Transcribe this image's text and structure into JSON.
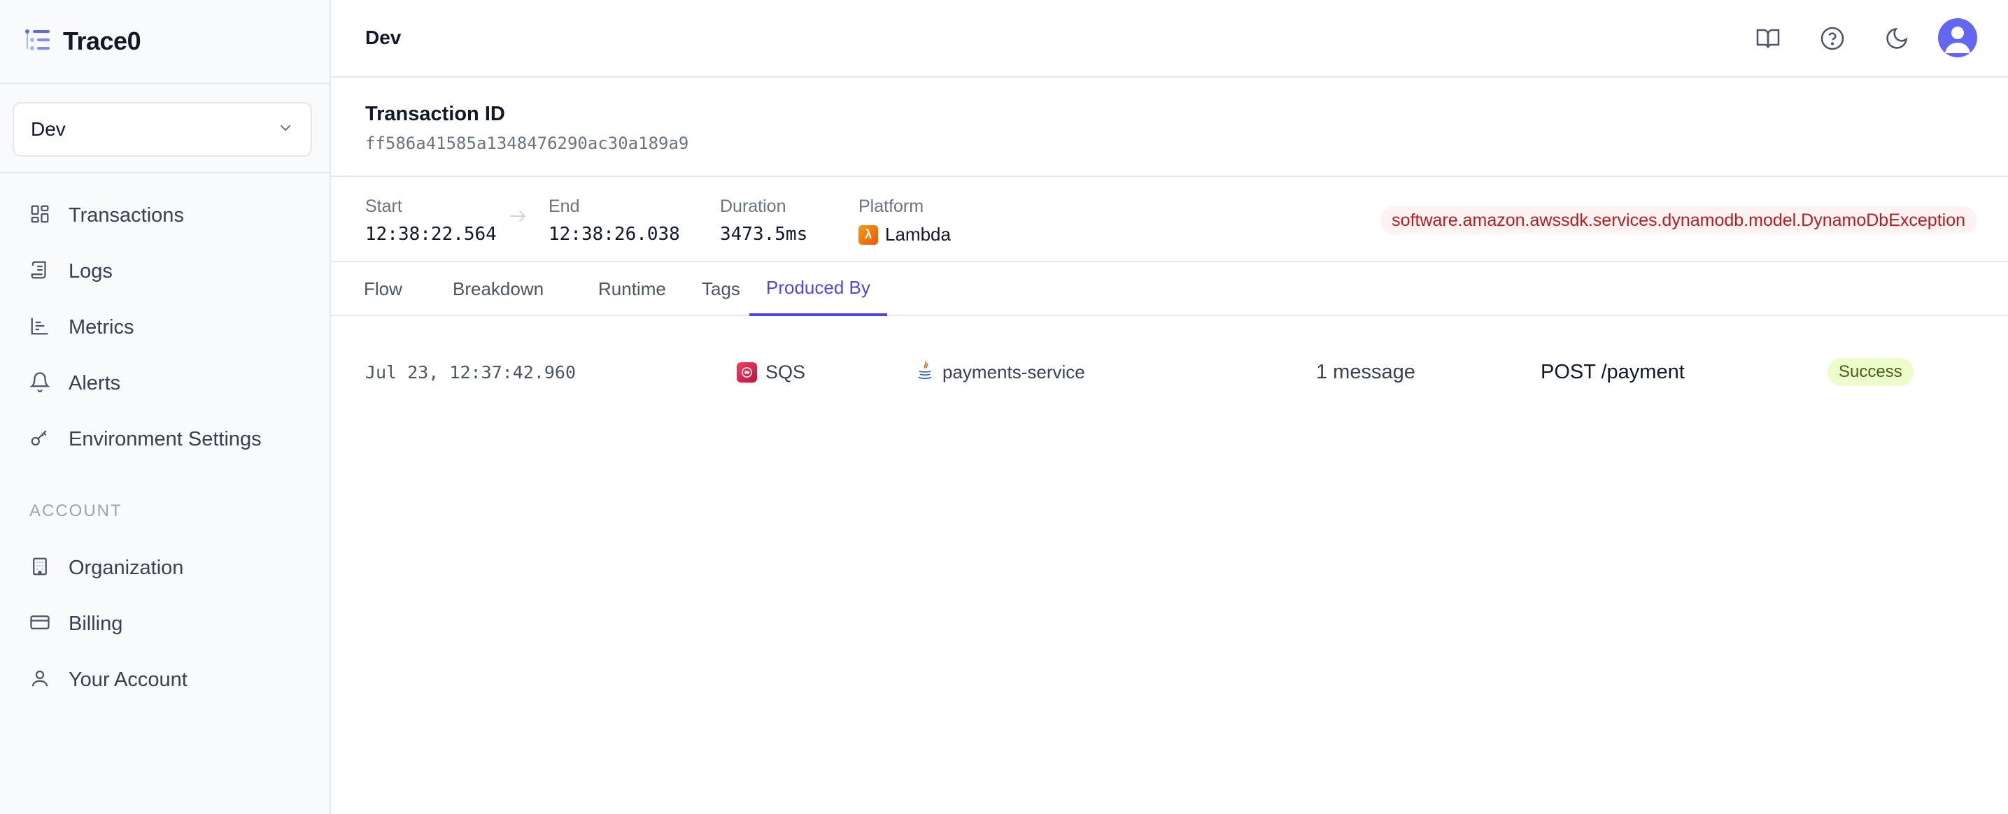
{
  "app": {
    "name": "Trace0"
  },
  "sidebar": {
    "environment": "Dev",
    "items": [
      {
        "label": "Transactions",
        "icon": "transactions-icon"
      },
      {
        "label": "Logs",
        "icon": "logs-icon"
      },
      {
        "label": "Metrics",
        "icon": "metrics-icon"
      },
      {
        "label": "Alerts",
        "icon": "bell-icon"
      },
      {
        "label": "Environment Settings",
        "icon": "key-icon"
      }
    ],
    "account_section": "ACCOUNT",
    "account_items": [
      {
        "label": "Organization",
        "icon": "building-icon"
      },
      {
        "label": "Billing",
        "icon": "credit-card-icon"
      },
      {
        "label": "Your Account",
        "icon": "user-icon"
      }
    ]
  },
  "topbar": {
    "title": "Dev",
    "icons": [
      "book-icon",
      "help-icon",
      "moon-icon",
      "avatar"
    ]
  },
  "transaction": {
    "label": "Transaction ID",
    "id": "ff586a41585a1348476290ac30a189a9",
    "start_label": "Start",
    "start": "12:38:22.564",
    "end_label": "End",
    "end": "12:38:26.038",
    "duration_label": "Duration",
    "duration": "3473.5ms",
    "platform_label": "Platform",
    "platform": "Lambda",
    "error": "software.amazon.awssdk.services.dynamodb.model.DynamoDbException"
  },
  "tabs": [
    "Flow",
    "Breakdown",
    "Runtime",
    "Tags",
    "Produced By"
  ],
  "active_tab": "Produced By",
  "rows": [
    {
      "timestamp": "Jul 23, 12:37:42.960",
      "source": "SQS",
      "service": "payments-service",
      "messages": "1 message",
      "endpoint": "POST /payment",
      "status": "Success"
    }
  ],
  "colors": {
    "accent": "#4f46e5",
    "error_text": "#b91c1c",
    "error_bg": "#fef2f2",
    "success_text": "#3f6212",
    "success_bg": "#ecfccb"
  }
}
